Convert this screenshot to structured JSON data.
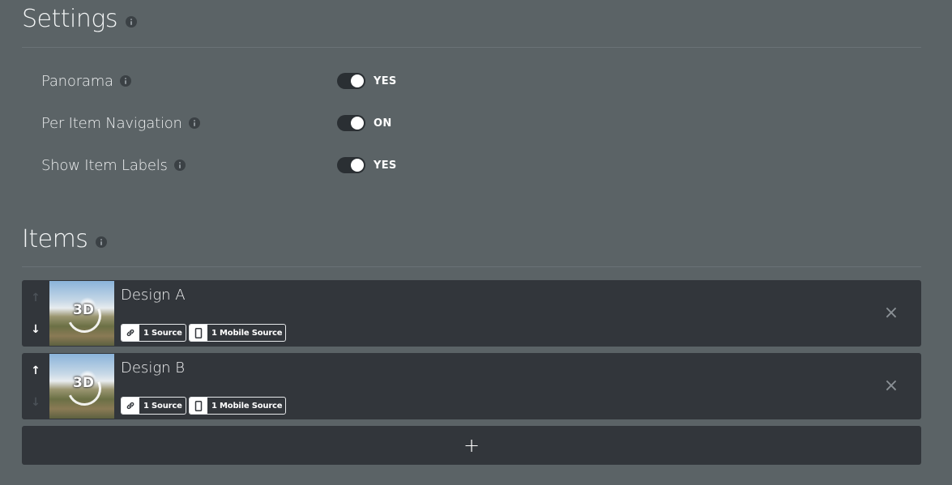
{
  "settings": {
    "title": "Settings",
    "rows": [
      {
        "label": "Panorama",
        "toggle_text": "YES"
      },
      {
        "label": "Per Item Navigation",
        "toggle_text": "ON"
      },
      {
        "label": "Show Item Labels",
        "toggle_text": "YES"
      }
    ]
  },
  "items": {
    "title": "Items",
    "list": [
      {
        "name": "Design A",
        "source_label": "1 Source",
        "mobile_source_label": "1 Mobile Source",
        "thumb_badge": "3D"
      },
      {
        "name": "Design B",
        "source_label": "1 Source",
        "mobile_source_label": "1 Mobile Source",
        "thumb_badge": "3D"
      }
    ],
    "add_label": "+"
  },
  "icons": {
    "info": "info-icon",
    "toggle": "toggle-switch",
    "arrow_up": "arrow-up-icon",
    "arrow_down": "arrow-down-icon",
    "link": "link-icon",
    "mobile": "mobile-icon",
    "close": "close-icon",
    "plus": "plus-icon"
  },
  "colors": {
    "background": "#5b6366",
    "card": "#32363b",
    "toggle_track": "#2a2f33",
    "text": "#ffffff"
  }
}
